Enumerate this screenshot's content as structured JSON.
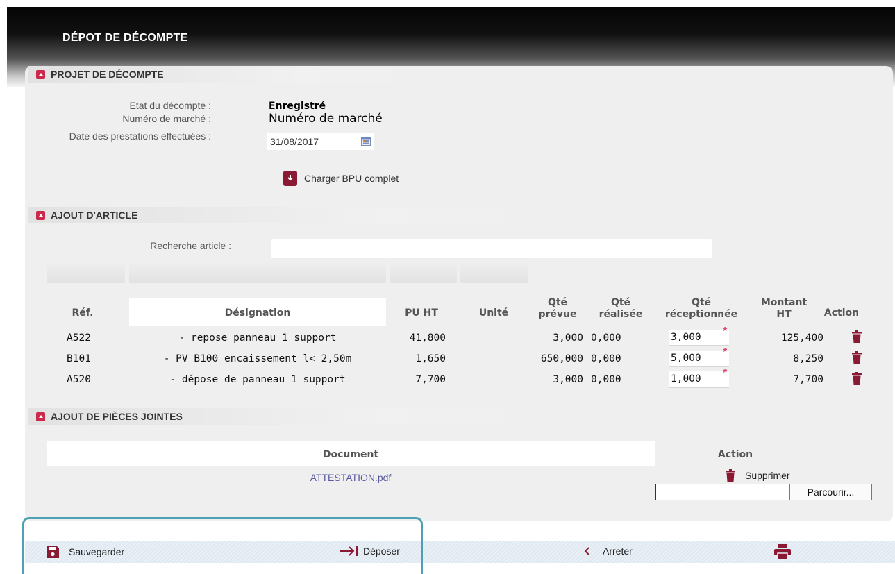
{
  "header": {
    "title": "DÉPOT DE DÉCOMPTE"
  },
  "projet": {
    "section_title": "PROJET DE DÉCOMPTE",
    "etat_label": "Etat du décompte :",
    "etat_value": "Enregistré",
    "numero_label": "Numéro de marché :",
    "numero_value": "Numéro de marché",
    "date_label": "Date des prestations effectuées :",
    "date_value": "31/08/2017",
    "bpu_label": "Charger BPU complet"
  },
  "ajout_article": {
    "section_title": "AJOUT D'ARTICLE",
    "search_label": "Recherche article :",
    "search_value": "",
    "headers": {
      "ref": "Réf.",
      "designation": "Désignation",
      "pu_ht": "PU HT",
      "unite": "Unité",
      "qte_prevue_1": "Qté",
      "qte_prevue_2": "prévue",
      "qte_realisee_1": "Qté",
      "qte_realisee_2": "réalisée",
      "qte_receptionnee_1": "Qté",
      "qte_receptionnee_2": "réceptionnée",
      "montant_1": "Montant",
      "montant_2": "HT",
      "action": "Action"
    },
    "rows": [
      {
        "ref": "A522",
        "designation": "- repose panneau 1 support",
        "pu_ht": "41,800",
        "unite": "",
        "qte_prevue": "3,000",
        "qte_realisee": "0,000",
        "qte_receptionnee": "3,000",
        "montant": "125,400"
      },
      {
        "ref": "B101",
        "designation": "- PV B100 encaissement l< 2,50m",
        "pu_ht": "1,650",
        "unite": "",
        "qte_prevue": "650,000",
        "qte_realisee": "0,000",
        "qte_receptionnee": "5,000",
        "montant": "8,250"
      },
      {
        "ref": "A520",
        "designation": "- dépose de panneau 1 support",
        "pu_ht": "7,700",
        "unite": "",
        "qte_prevue": "3,000",
        "qte_realisee": "0,000",
        "qte_receptionnee": "1,000",
        "montant": "7,700"
      }
    ],
    "required_mark": "*"
  },
  "pieces_jointes": {
    "section_title": "AJOUT DE PIÈCES JOINTES",
    "col_document": "Document",
    "col_action": "Action",
    "files": [
      {
        "name": "ATTESTATION.pdf",
        "action": "Supprimer"
      }
    ],
    "browse_label": "Parcourir..."
  },
  "toolbar": {
    "save": "Sauvegarder",
    "deposit": "Déposer",
    "stop": "Arreter"
  },
  "colors": {
    "accent": "#8a1a33",
    "toggle": "#cc2a4c",
    "link": "#5a5aa0",
    "highlight": "#4ea1b4"
  }
}
